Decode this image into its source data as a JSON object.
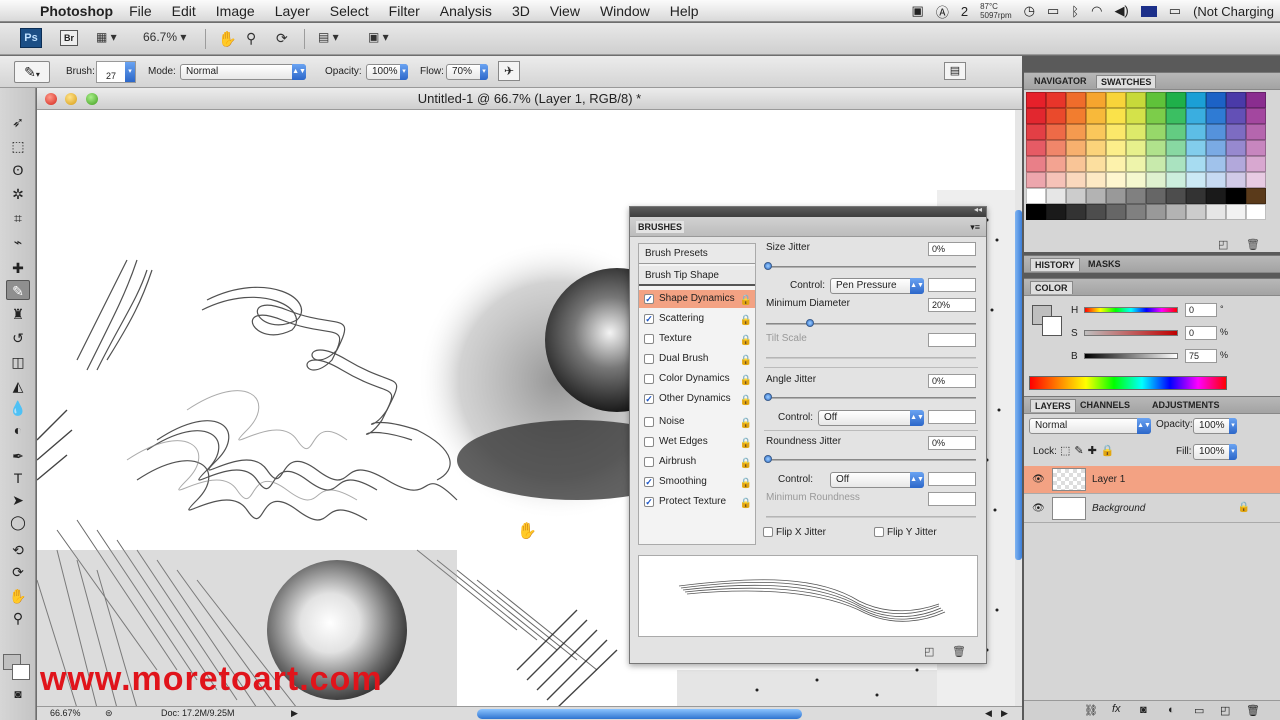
{
  "menubar": {
    "app_name": "Photoshop",
    "menus": [
      "File",
      "Edit",
      "Image",
      "Layer",
      "Select",
      "Filter",
      "Analysis",
      "3D",
      "View",
      "Window",
      "Help"
    ],
    "status_num": "2",
    "temperature": "87°C",
    "fan": "5097rpm",
    "battery": "(Not Charging"
  },
  "appbar": {
    "ps_logo": "Ps",
    "br_logo": "Br",
    "zoom": "66.7%"
  },
  "options": {
    "brush_label": "Brush:",
    "brush_size": "27",
    "mode_label": "Mode:",
    "mode_value": "Normal",
    "opacity_label": "Opacity:",
    "opacity_value": "100%",
    "flow_label": "Flow:",
    "flow_value": "70%"
  },
  "document": {
    "title": "Untitled-1 @ 66.7% (Layer 1, RGB/8) *",
    "watermark": "www.moretoart.com",
    "status_zoom": "66.67%",
    "doc_info": "Doc: 17.2M/9.25M"
  },
  "brushes": {
    "panel_title": "BRUSHES",
    "presets_button": "Brush Presets",
    "tip_shape": "Brush Tip Shape",
    "items": [
      {
        "label": "Shape Dynamics",
        "checked": true,
        "selected": true
      },
      {
        "label": "Scattering",
        "checked": true,
        "selected": false
      },
      {
        "label": "Texture",
        "checked": false,
        "selected": false
      },
      {
        "label": "Dual Brush",
        "checked": false,
        "selected": false
      },
      {
        "label": "Color Dynamics",
        "checked": false,
        "selected": false
      },
      {
        "label": "Other Dynamics",
        "checked": true,
        "selected": false
      },
      {
        "label": "Noise",
        "checked": false,
        "selected": false
      },
      {
        "label": "Wet Edges",
        "checked": false,
        "selected": false
      },
      {
        "label": "Airbrush",
        "checked": false,
        "selected": false
      },
      {
        "label": "Smoothing",
        "checked": true,
        "selected": false
      },
      {
        "label": "Protect Texture",
        "checked": true,
        "selected": false
      }
    ],
    "size_jitter_label": "Size Jitter",
    "size_jitter_value": "0%",
    "control_label": "Control:",
    "control1_value": "Pen Pressure",
    "min_diameter_label": "Minimum Diameter",
    "min_diameter_value": "20%",
    "tilt_scale_label": "Tilt Scale",
    "angle_jitter_label": "Angle Jitter",
    "angle_jitter_value": "0%",
    "control2_value": "Off",
    "roundness_jitter_label": "Roundness Jitter",
    "roundness_jitter_value": "0%",
    "control3_value": "Off",
    "min_roundness_label": "Minimum Roundness",
    "flip_x_label": "Flip X Jitter",
    "flip_y_label": "Flip Y Jitter"
  },
  "panels": {
    "navigator_tab": "NAVIGATOR",
    "swatches_tab": "SWATCHES",
    "history_tab": "HISTORY",
    "masks_tab": "MASKS",
    "color_tab": "COLOR",
    "h_label": "H",
    "s_label": "S",
    "b_label": "B",
    "h_value": "0",
    "s_value": "0",
    "b_value": "75",
    "h_unit": "°",
    "s_unit": "%",
    "b_unit": "%",
    "layers_tab": "LAYERS",
    "channels_tab": "CHANNELS",
    "adjustments_tab": "ADJUSTMENTS",
    "blend_mode": "Normal",
    "opacity_label": "Opacity:",
    "opacity_value": "100%",
    "lock_label": "Lock:",
    "fill_label": "Fill:",
    "fill_value": "100%",
    "layers": [
      {
        "name": "Layer 1",
        "selected": true
      },
      {
        "name": "Background",
        "selected": false
      }
    ]
  },
  "swatch_colors": [
    "#e6202a",
    "#e8352a",
    "#ef6c2b",
    "#f6a52e",
    "#f8d43a",
    "#c7d93a",
    "#5fc23a",
    "#1fb04a",
    "#1b9fd6",
    "#1c62c6",
    "#4a3aa8",
    "#8a2d8f",
    "#e2272f",
    "#ea4a2c",
    "#f27d2f",
    "#f8b93a",
    "#fae24a",
    "#d4e24a",
    "#7ccd4a",
    "#3bbf62",
    "#3aaee0",
    "#2f7bd4",
    "#6350b6",
    "#a3479f",
    "#e33f45",
    "#ee6a47",
    "#f59a4f",
    "#fac75b",
    "#fbe86a",
    "#ddea6a",
    "#97d86a",
    "#63cc82",
    "#5dbee6",
    "#5592dc",
    "#7d6cc2",
    "#b566ae",
    "#e65b65",
    "#f0866a",
    "#f7b06e",
    "#fbd37a",
    "#fcee8a",
    "#e7f08c",
    "#b0e28c",
    "#88d8a2",
    "#82cdec",
    "#7aaae4",
    "#9789cf",
    "#c786bf",
    "#e97f88",
    "#f3a391",
    "#f9c597",
    "#fcdf9f",
    "#fdf2ac",
    "#eef4ab",
    "#c8eaac",
    "#aae3c0",
    "#a7dcf1",
    "#a0c2eb",
    "#b2a8db",
    "#d8a8d0",
    "#eda6ad",
    "#f6c2b8",
    "#fad8bd",
    "#fde9c4",
    "#fef6cf",
    "#f5f8cf",
    "#dff1cf",
    "#cceedd",
    "#cce9f5",
    "#c7daf2",
    "#d1cae7",
    "#e8cbe3",
    "#ffffff",
    "#e6e6e6",
    "#cccccc",
    "#b3b3b3",
    "#999999",
    "#808080",
    "#666666",
    "#4d4d4d",
    "#333333",
    "#1a1a1a",
    "#000000",
    "#5a3a1a",
    "#000000",
    "#1a1a1a",
    "#333333",
    "#4d4d4d",
    "#666666",
    "#808080",
    "#999999",
    "#b3b3b3",
    "#cccccc",
    "#e6e6e6",
    "#f2f2f2",
    "#ffffff"
  ]
}
